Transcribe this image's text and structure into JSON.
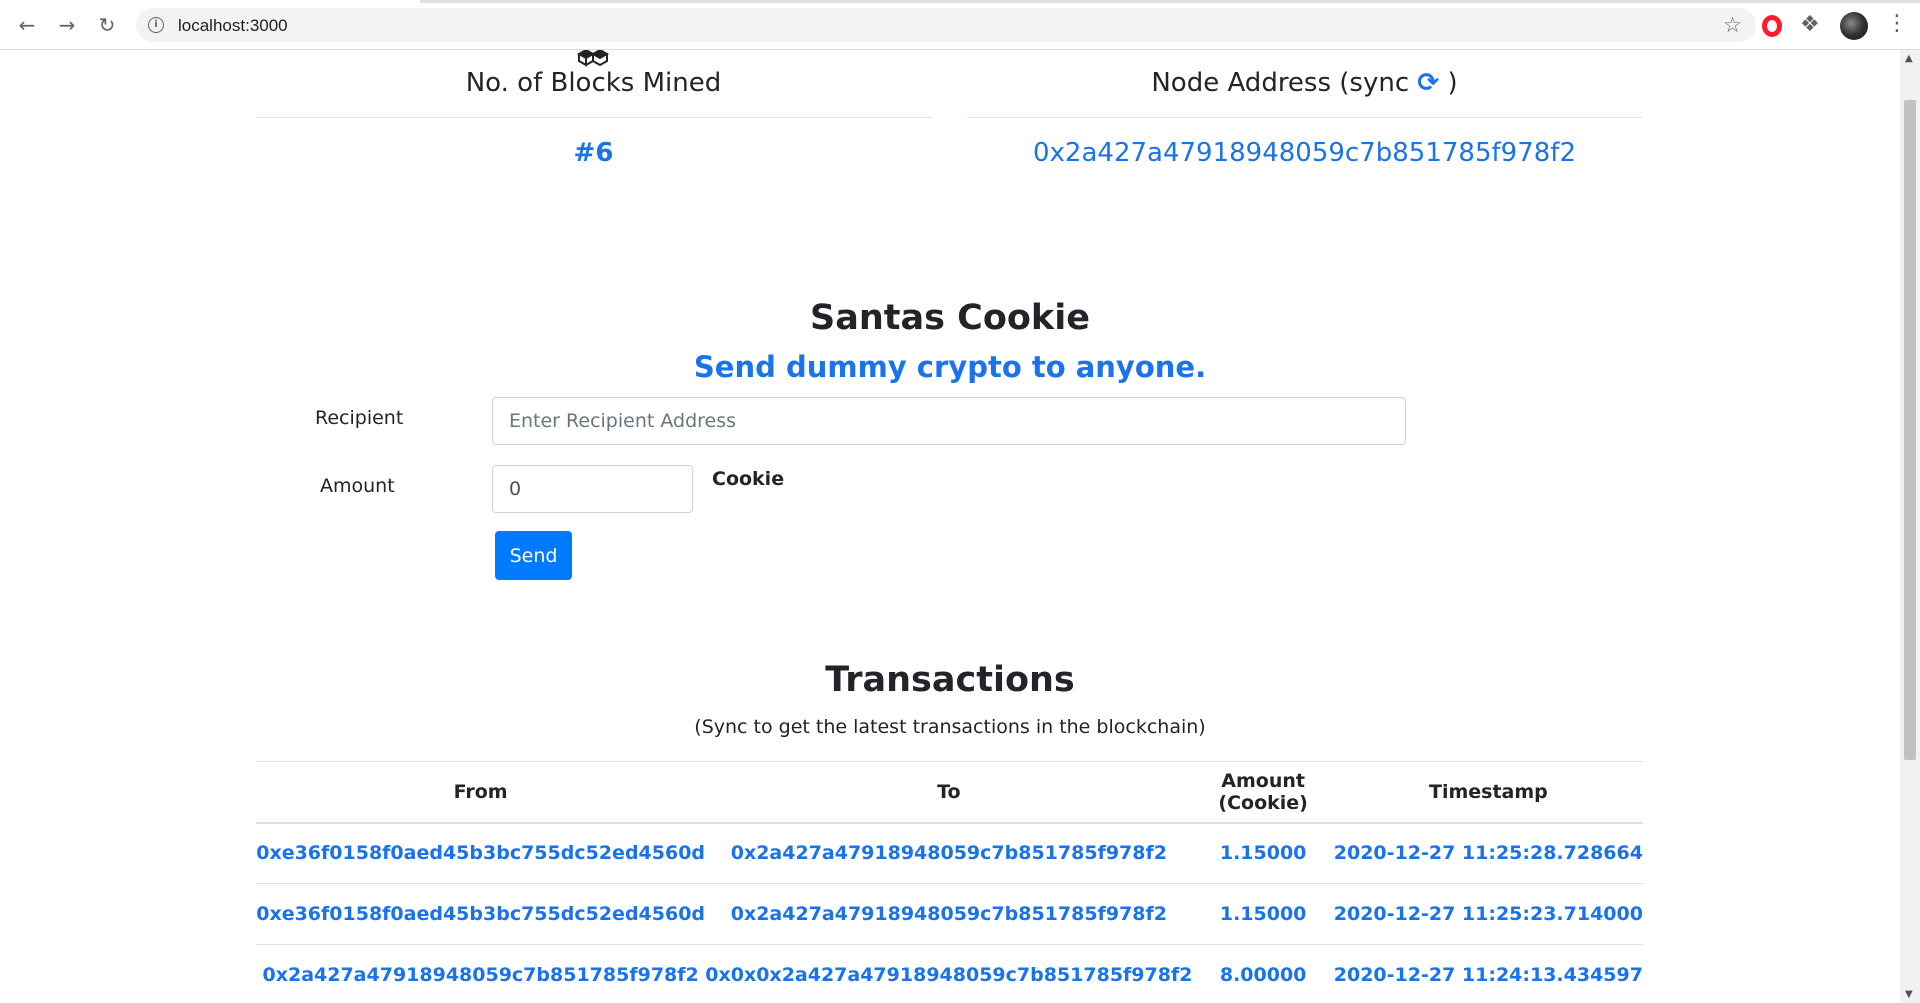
{
  "browser": {
    "url": "localhost:3000"
  },
  "stats": {
    "blocks_label": "No. of Blocks Mined",
    "blocks_value": "#6",
    "node_label_prefix": "Node Address (sync",
    "node_label_suffix": ")",
    "node_value": "0x2a427a47918948059c7b851785f978f2"
  },
  "hero": {
    "title": "Santas Cookie",
    "subtitle": "Send dummy crypto to anyone."
  },
  "form": {
    "recipient_label": "Recipient",
    "recipient_placeholder": "Enter Recipient Address",
    "amount_label": "Amount",
    "amount_value": "0",
    "unit": "Cookie",
    "send_label": "Send"
  },
  "transactions": {
    "title": "Transactions",
    "subtitle": "(Sync to get the latest transactions in the blockchain)",
    "columns": [
      "From",
      "To",
      "Amount (Cookie)",
      "Timestamp"
    ],
    "rows": [
      [
        "0xe36f0158f0aed45b3bc755dc52ed4560d",
        "0x2a427a47918948059c7b851785f978f2",
        "1.15000",
        "2020-12-27 11:25:28.728664"
      ],
      [
        "0xe36f0158f0aed45b3bc755dc52ed4560d",
        "0x2a427a47918948059c7b851785f978f2",
        "1.15000",
        "2020-12-27 11:25:23.714000"
      ],
      [
        "0x2a427a47918948059c7b851785f978f2",
        "0x0x0x2a427a47918948059c7b851785f978f2",
        "8.00000",
        "2020-12-27 11:24:13.434597"
      ]
    ]
  },
  "colors": {
    "link_blue": "#1a73e8",
    "button_blue": "#007bff"
  },
  "icons": [
    "back-arrow-icon",
    "forward-arrow-icon",
    "reload-icon",
    "info-icon",
    "star-icon",
    "opera-icon",
    "puzzle-icon",
    "kebab-menu-icon",
    "cubes-icon",
    "sync-icon"
  ]
}
